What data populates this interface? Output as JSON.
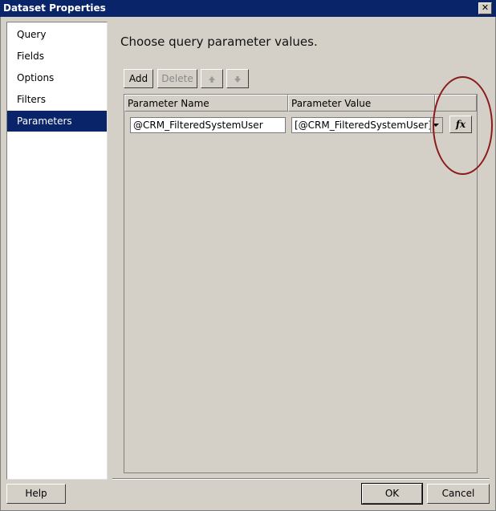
{
  "window": {
    "title": "Dataset Properties",
    "close_glyph": "✕"
  },
  "sidebar": {
    "items": [
      {
        "label": "Query"
      },
      {
        "label": "Fields"
      },
      {
        "label": "Options"
      },
      {
        "label": "Filters"
      },
      {
        "label": "Parameters",
        "selected": true
      }
    ]
  },
  "main": {
    "heading": "Choose query parameter values.",
    "toolbar": {
      "add_label": "Add",
      "delete_label": "Delete",
      "move_up_icon": "arrow-up-icon",
      "move_down_icon": "arrow-down-icon"
    },
    "grid": {
      "columns": [
        "Parameter Name",
        "Parameter Value"
      ],
      "rows": [
        {
          "name": "@CRM_FilteredSystemUser",
          "value": "[@CRM_FilteredSystemUser]"
        }
      ]
    },
    "fx_label": "fx"
  },
  "footer": {
    "help_label": "Help",
    "ok_label": "OK",
    "cancel_label": "Cancel"
  },
  "colors": {
    "title_bar": "#0a246a",
    "selection": "#0a246a",
    "annotation_circle": "#8b1a1a",
    "dialog_bg": "#d4d0c8"
  }
}
